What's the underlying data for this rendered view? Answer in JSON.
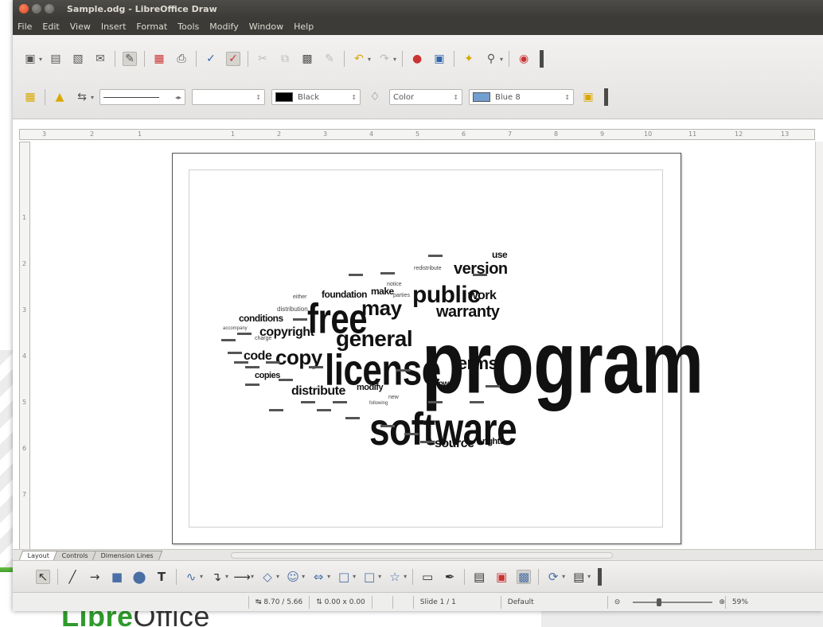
{
  "window": {
    "title": "Sample.odg - LibreOffice Draw"
  },
  "menubar": {
    "items": [
      "File",
      "Edit",
      "View",
      "Insert",
      "Format",
      "Tools",
      "Modify",
      "Window",
      "Help"
    ]
  },
  "toolbar2": {
    "line_color": "Black",
    "area_style": "Color",
    "area_color": "Blue 8",
    "line_color_hex": "#000000",
    "area_color_hex": "#729fcf"
  },
  "ruler": {
    "h_ticks": [
      "3",
      "2",
      "1",
      "1",
      "2",
      "3",
      "4",
      "5",
      "6",
      "7",
      "8",
      "9",
      "10",
      "11",
      "12",
      "13"
    ],
    "v_ticks": [
      "1",
      "2",
      "3",
      "4",
      "5",
      "6",
      "7"
    ]
  },
  "word_cloud": {
    "words": [
      {
        "text": "program",
        "size": 88
      },
      {
        "text": "software",
        "size": 46
      },
      {
        "text": "license",
        "size": 44
      },
      {
        "text": "free",
        "size": 42
      },
      {
        "text": "public",
        "size": 30
      },
      {
        "text": "general",
        "size": 28
      },
      {
        "text": "may",
        "size": 26
      },
      {
        "text": "copy",
        "size": 26
      },
      {
        "text": "warranty",
        "size": 20
      },
      {
        "text": "terms",
        "size": 22
      },
      {
        "text": "version",
        "size": 20
      },
      {
        "text": "copyright",
        "size": 16
      },
      {
        "text": "work",
        "size": 16
      },
      {
        "text": "code",
        "size": 16
      },
      {
        "text": "distribute",
        "size": 16
      },
      {
        "text": "source",
        "size": 16
      },
      {
        "text": "make",
        "size": 12
      },
      {
        "text": "foundation",
        "size": 12
      },
      {
        "text": "conditions",
        "size": 12
      },
      {
        "text": "modify",
        "size": 11
      },
      {
        "text": "copies",
        "size": 11
      },
      {
        "text": "rights",
        "size": 11
      },
      {
        "text": "show",
        "size": 10
      },
      {
        "text": "use",
        "size": 12
      },
      {
        "text": "distribution",
        "size": 8
      },
      {
        "text": "redistribute",
        "size": 7
      },
      {
        "text": "notice",
        "size": 7
      },
      {
        "text": "parties",
        "size": 7
      },
      {
        "text": "either",
        "size": 7
      },
      {
        "text": "charge",
        "size": 7
      },
      {
        "text": "accompany",
        "size": 6
      },
      {
        "text": "following",
        "size": 6
      },
      {
        "text": "new",
        "size": 7
      }
    ]
  },
  "tabs": {
    "items": [
      "Layout",
      "Controls",
      "Dimension Lines"
    ]
  },
  "statusbar": {
    "position": "8.70 / 5.66",
    "size": "0.00 x 0.00",
    "slide": "Slide 1 / 1",
    "master": "Default",
    "zoom": "59%"
  },
  "brand": {
    "part1": "Libre",
    "part2": "Office"
  },
  "colors": {
    "title_bar": "#3c3b37",
    "brand_green": "#2e9b2c"
  }
}
